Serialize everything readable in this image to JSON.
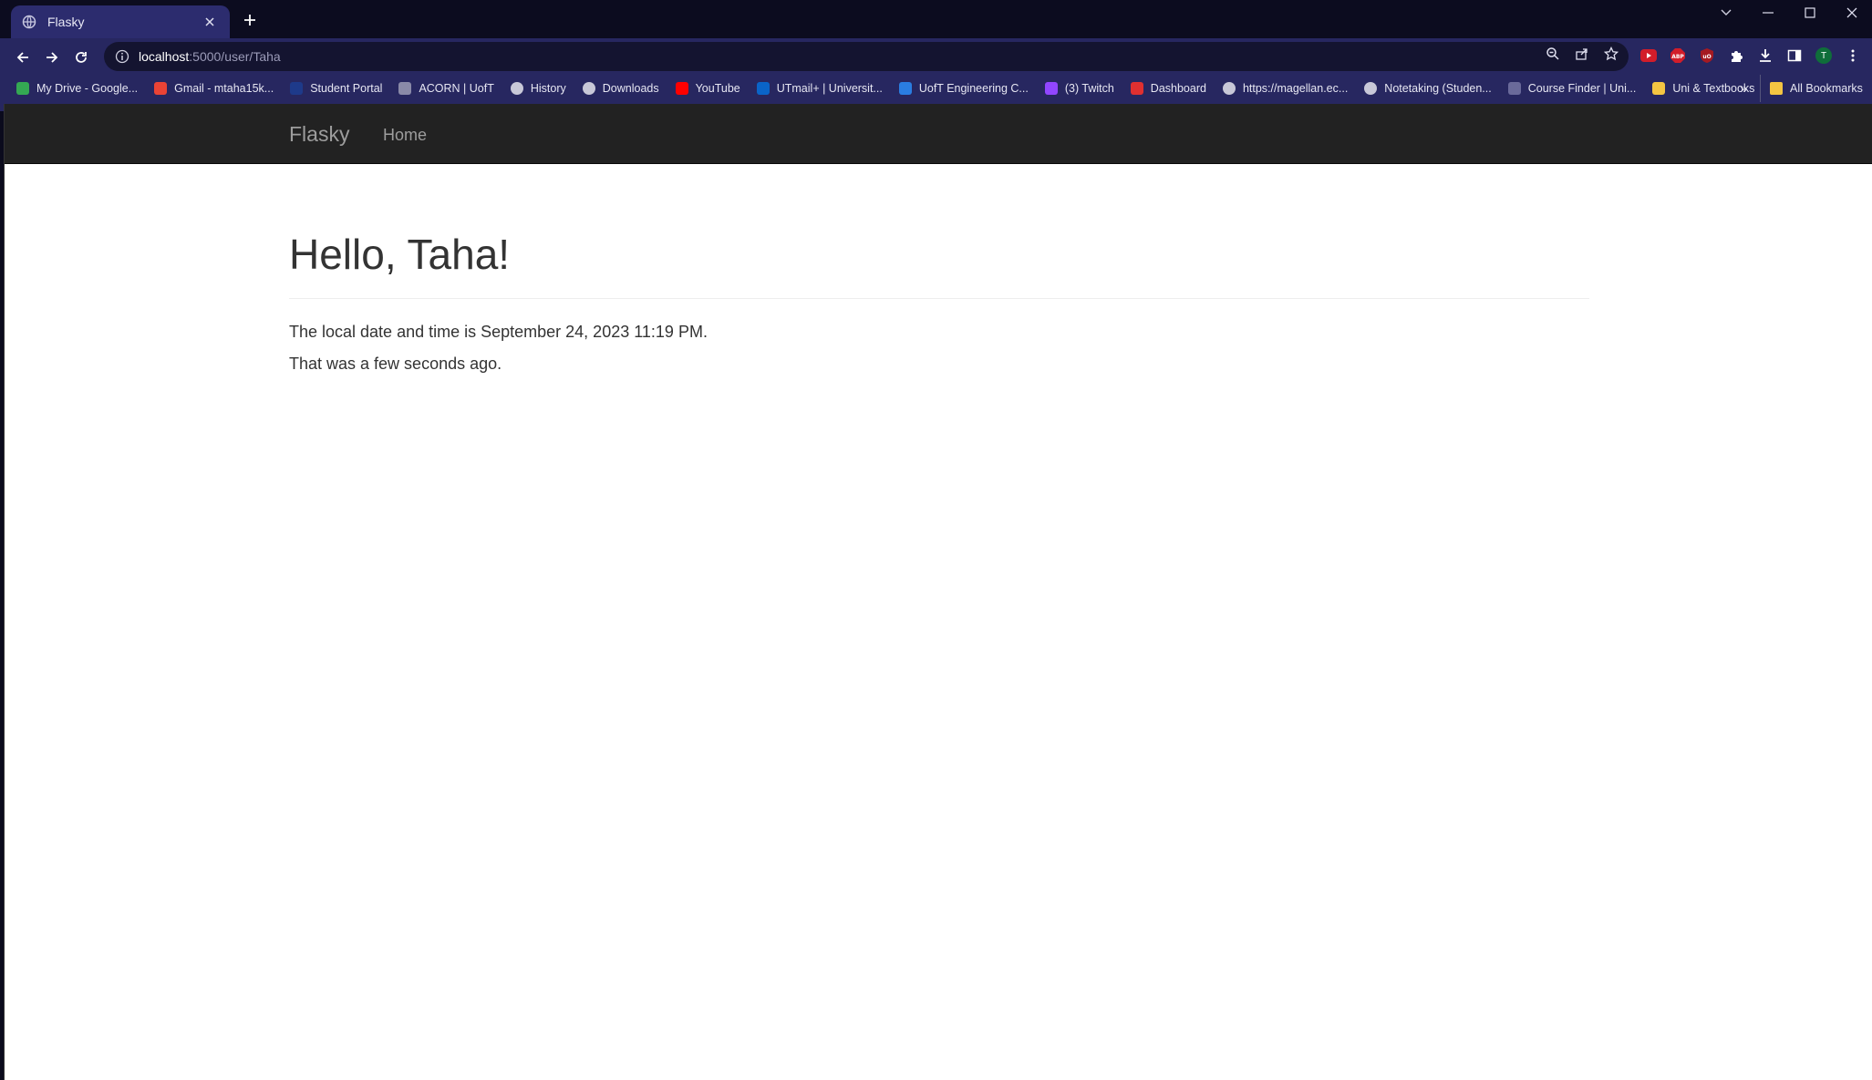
{
  "browser": {
    "tab_title": "Flasky",
    "url_host": "localhost",
    "url_path": ":5000/user/Taha",
    "bookmarks": [
      {
        "label": "My Drive - Google...",
        "icon": "drive-icon",
        "color": "#34a853"
      },
      {
        "label": "Gmail - mtaha15k...",
        "icon": "gmail-icon",
        "color": "#ea4335"
      },
      {
        "label": "Student Portal",
        "icon": "portal-icon",
        "color": "#1e3a8a"
      },
      {
        "label": "ACORN | UofT",
        "icon": "acorn-icon",
        "color": "#8a8aa8"
      },
      {
        "label": "History",
        "icon": "history-icon",
        "color": "#c8c8d8"
      },
      {
        "label": "Downloads",
        "icon": "download-icon",
        "color": "#c8c8d8"
      },
      {
        "label": "YouTube",
        "icon": "youtube-icon",
        "color": "#ff0000"
      },
      {
        "label": "UTmail+ | Universit...",
        "icon": "outlook-icon",
        "color": "#0a64c8"
      },
      {
        "label": "UofT Engineering C...",
        "icon": "engineering-icon",
        "color": "#2a7de1"
      },
      {
        "label": "(3) Twitch",
        "icon": "twitch-icon",
        "color": "#9146ff"
      },
      {
        "label": "Dashboard",
        "icon": "dashboard-icon",
        "color": "#e03030"
      },
      {
        "label": "https://magellan.ec...",
        "icon": "globe-icon",
        "color": "#c8c8d8"
      },
      {
        "label": "Notetaking (Studen...",
        "icon": "globe-icon",
        "color": "#c8c8d8"
      },
      {
        "label": "Course Finder | Uni...",
        "icon": "coursefinder-icon",
        "color": "#6a6a9a"
      },
      {
        "label": "Uni & Textbooks",
        "icon": "folder-icon",
        "color": "#f4c542"
      }
    ],
    "more_bookmarks": "»",
    "all_bookmarks": "All Bookmarks",
    "profile_initial": "T",
    "extensions": [
      "adblock-icon",
      "abp-icon",
      "ublock-icon"
    ]
  },
  "page": {
    "brand": "Flasky",
    "nav_home": "Home",
    "heading": "Hello, Taha!",
    "local_time_text": "The local date and time is September 24, 2023 11:19 PM.",
    "relative_time_text": "That was a few seconds ago."
  }
}
